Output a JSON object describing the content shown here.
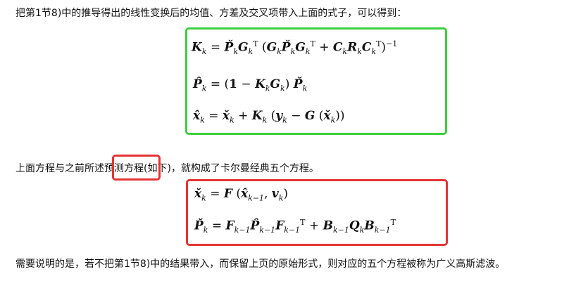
{
  "text": {
    "line1": "把第1节8)中的推导得出的线性变换后的均值、方差及交叉项带入上面的式子，可以得到：",
    "line2_before": "上面方程与之前所述",
    "line2_highlight": "预测方程",
    "line2_after": "(如下)，就构成了卡尔曼经典五个方程。",
    "line3": "需要说明的是，若不把第1节8)中的结果带入，而保留上页的原始形式，则对应的五个方程被称为广义高斯滤波。"
  },
  "equations": {
    "eq1": "K_k = P̌_k G_k^T (G_k P̌_k G_k^T + C_k R_k C_k^T)^{-1}",
    "eq2": "P̂_k = (1 − K_k G_k) P̌_k",
    "eq3": "x̂_k = x̌_k + K_k (y_k − G(x̌_k))",
    "eq4": "x̌_k = F(x̂_{k−1}, v_k)",
    "eq5": "P̌_k = F_{k−1} P̂_{k−1} F_{k−1}^T + B_{k−1} Q_k B_{k−1}^T"
  },
  "colors": {
    "green_box": "#3ad03a",
    "red_box": "#e23434"
  }
}
